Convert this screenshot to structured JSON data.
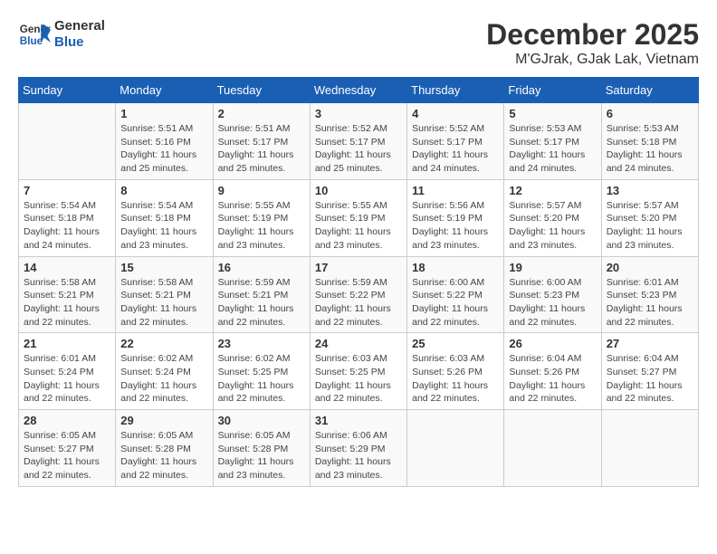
{
  "header": {
    "logo_line1": "General",
    "logo_line2": "Blue",
    "title": "December 2025",
    "subtitle": "M'GJrak, GJak Lak, Vietnam"
  },
  "days_of_week": [
    "Sunday",
    "Monday",
    "Tuesday",
    "Wednesday",
    "Thursday",
    "Friday",
    "Saturday"
  ],
  "weeks": [
    [
      {
        "day": "",
        "info": ""
      },
      {
        "day": "1",
        "info": "Sunrise: 5:51 AM\nSunset: 5:16 PM\nDaylight: 11 hours\nand 25 minutes."
      },
      {
        "day": "2",
        "info": "Sunrise: 5:51 AM\nSunset: 5:17 PM\nDaylight: 11 hours\nand 25 minutes."
      },
      {
        "day": "3",
        "info": "Sunrise: 5:52 AM\nSunset: 5:17 PM\nDaylight: 11 hours\nand 25 minutes."
      },
      {
        "day": "4",
        "info": "Sunrise: 5:52 AM\nSunset: 5:17 PM\nDaylight: 11 hours\nand 24 minutes."
      },
      {
        "day": "5",
        "info": "Sunrise: 5:53 AM\nSunset: 5:17 PM\nDaylight: 11 hours\nand 24 minutes."
      },
      {
        "day": "6",
        "info": "Sunrise: 5:53 AM\nSunset: 5:18 PM\nDaylight: 11 hours\nand 24 minutes."
      }
    ],
    [
      {
        "day": "7",
        "info": "Sunrise: 5:54 AM\nSunset: 5:18 PM\nDaylight: 11 hours\nand 24 minutes."
      },
      {
        "day": "8",
        "info": "Sunrise: 5:54 AM\nSunset: 5:18 PM\nDaylight: 11 hours\nand 23 minutes."
      },
      {
        "day": "9",
        "info": "Sunrise: 5:55 AM\nSunset: 5:19 PM\nDaylight: 11 hours\nand 23 minutes."
      },
      {
        "day": "10",
        "info": "Sunrise: 5:55 AM\nSunset: 5:19 PM\nDaylight: 11 hours\nand 23 minutes."
      },
      {
        "day": "11",
        "info": "Sunrise: 5:56 AM\nSunset: 5:19 PM\nDaylight: 11 hours\nand 23 minutes."
      },
      {
        "day": "12",
        "info": "Sunrise: 5:57 AM\nSunset: 5:20 PM\nDaylight: 11 hours\nand 23 minutes."
      },
      {
        "day": "13",
        "info": "Sunrise: 5:57 AM\nSunset: 5:20 PM\nDaylight: 11 hours\nand 23 minutes."
      }
    ],
    [
      {
        "day": "14",
        "info": "Sunrise: 5:58 AM\nSunset: 5:21 PM\nDaylight: 11 hours\nand 22 minutes."
      },
      {
        "day": "15",
        "info": "Sunrise: 5:58 AM\nSunset: 5:21 PM\nDaylight: 11 hours\nand 22 minutes."
      },
      {
        "day": "16",
        "info": "Sunrise: 5:59 AM\nSunset: 5:21 PM\nDaylight: 11 hours\nand 22 minutes."
      },
      {
        "day": "17",
        "info": "Sunrise: 5:59 AM\nSunset: 5:22 PM\nDaylight: 11 hours\nand 22 minutes."
      },
      {
        "day": "18",
        "info": "Sunrise: 6:00 AM\nSunset: 5:22 PM\nDaylight: 11 hours\nand 22 minutes."
      },
      {
        "day": "19",
        "info": "Sunrise: 6:00 AM\nSunset: 5:23 PM\nDaylight: 11 hours\nand 22 minutes."
      },
      {
        "day": "20",
        "info": "Sunrise: 6:01 AM\nSunset: 5:23 PM\nDaylight: 11 hours\nand 22 minutes."
      }
    ],
    [
      {
        "day": "21",
        "info": "Sunrise: 6:01 AM\nSunset: 5:24 PM\nDaylight: 11 hours\nand 22 minutes."
      },
      {
        "day": "22",
        "info": "Sunrise: 6:02 AM\nSunset: 5:24 PM\nDaylight: 11 hours\nand 22 minutes."
      },
      {
        "day": "23",
        "info": "Sunrise: 6:02 AM\nSunset: 5:25 PM\nDaylight: 11 hours\nand 22 minutes."
      },
      {
        "day": "24",
        "info": "Sunrise: 6:03 AM\nSunset: 5:25 PM\nDaylight: 11 hours\nand 22 minutes."
      },
      {
        "day": "25",
        "info": "Sunrise: 6:03 AM\nSunset: 5:26 PM\nDaylight: 11 hours\nand 22 minutes."
      },
      {
        "day": "26",
        "info": "Sunrise: 6:04 AM\nSunset: 5:26 PM\nDaylight: 11 hours\nand 22 minutes."
      },
      {
        "day": "27",
        "info": "Sunrise: 6:04 AM\nSunset: 5:27 PM\nDaylight: 11 hours\nand 22 minutes."
      }
    ],
    [
      {
        "day": "28",
        "info": "Sunrise: 6:05 AM\nSunset: 5:27 PM\nDaylight: 11 hours\nand 22 minutes."
      },
      {
        "day": "29",
        "info": "Sunrise: 6:05 AM\nSunset: 5:28 PM\nDaylight: 11 hours\nand 22 minutes."
      },
      {
        "day": "30",
        "info": "Sunrise: 6:05 AM\nSunset: 5:28 PM\nDaylight: 11 hours\nand 23 minutes."
      },
      {
        "day": "31",
        "info": "Sunrise: 6:06 AM\nSunset: 5:29 PM\nDaylight: 11 hours\nand 23 minutes."
      },
      {
        "day": "",
        "info": ""
      },
      {
        "day": "",
        "info": ""
      },
      {
        "day": "",
        "info": ""
      }
    ]
  ]
}
